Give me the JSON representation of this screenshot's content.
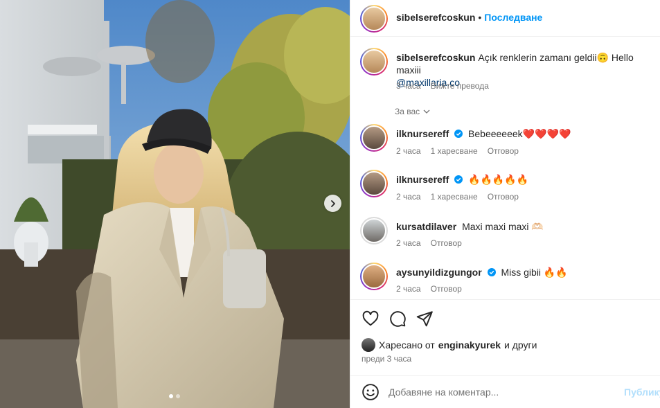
{
  "post": {
    "author": "sibelserefcoskun",
    "follow_label": "Последване",
    "separator": "•",
    "carousel_dots": 2,
    "active_dot": 1
  },
  "caption": {
    "username": "sibelserefcoskun",
    "text": "Açık renklerin zamanı geldii🙃 Hello maxiii",
    "mention": "@maxillaria.co",
    "time": "3 часа",
    "translate": "Вижте превода"
  },
  "for_you_label": "За вас",
  "comments": [
    {
      "username": "ilknursereff",
      "verified": true,
      "text": "Bebeeeeeek❤️❤️❤️❤️",
      "time": "2 часа",
      "likes": "1 харесване",
      "reply": "Отговор"
    },
    {
      "username": "ilknursereff",
      "verified": true,
      "text": "🔥🔥🔥🔥🔥",
      "time": "2 часа",
      "likes": "1 харесване",
      "reply": "Отговор"
    },
    {
      "username": "kursatdilaver",
      "verified": false,
      "text": "Maxi maxi maxi 🫶🏻",
      "time": "2 часа",
      "likes": "",
      "reply": "Отговор"
    },
    {
      "username": "aysunyildizgungor",
      "verified": true,
      "text": "Miss gibii 🔥🔥",
      "time": "2 часа",
      "likes": "",
      "reply": "Отговор"
    }
  ],
  "likes": {
    "prefix": "Харесано от",
    "user": "enginakyurek",
    "suffix": "и други",
    "time": "преди 3 часа"
  },
  "add_comment": {
    "placeholder": "Добавяне на коментар...",
    "publish": "Публикуване"
  },
  "colors": {
    "accent": "#0095f6",
    "muted": "#737373",
    "publish_disabled": "#b2dffc"
  },
  "icons": [
    "chevron-right-icon",
    "heart-icon",
    "comment-icon",
    "share-icon",
    "emoji-icon",
    "verified-icon",
    "chevron-down-icon"
  ]
}
